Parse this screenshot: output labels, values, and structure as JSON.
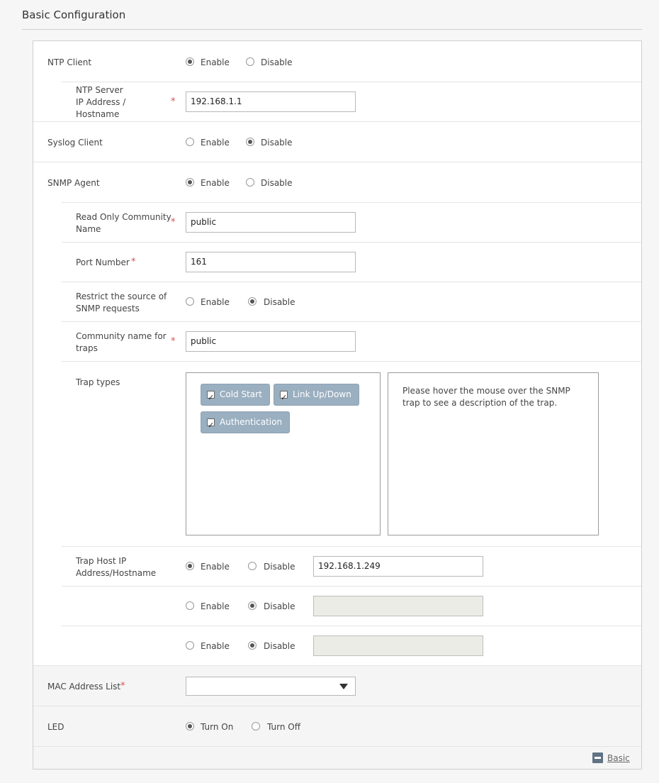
{
  "section_title": "Basic Configuration",
  "ntp": {
    "label": "NTP Client",
    "enable": "Enable",
    "disable": "Disable",
    "server_label_1": "NTP Server",
    "server_label_2": "IP Address /",
    "server_label_3": "Hostname",
    "server_value": "192.168.1.1"
  },
  "syslog": {
    "label": "Syslog Client",
    "enable": "Enable",
    "disable": "Disable"
  },
  "snmp": {
    "label": "SNMP Agent",
    "enable": "Enable",
    "disable": "Disable",
    "ro_label_1": "Read Only Community",
    "ro_label_2": "Name",
    "ro_value": "public",
    "port_label": "Port Number",
    "port_value": "161",
    "restrict_label_1": "Restrict the source of",
    "restrict_label_2": "SNMP requests",
    "trap_comm_label_1": "Community name for",
    "trap_comm_label_2": "traps",
    "trap_comm_value": "public",
    "trap_types_label": "Trap types",
    "trap_types": [
      "Cold Start",
      "Link Up/Down",
      "Authentication"
    ],
    "trap_hint": "Please hover the mouse over the SNMP trap to see a description of the trap.",
    "trap_host_label_1": "Trap Host IP",
    "trap_host_label_2": "Address/Hostname",
    "trap_host_value": "192.168.1.249"
  },
  "required_mark": "*",
  "mac": {
    "label": "MAC Address List",
    "value": ""
  },
  "led": {
    "label": "LED",
    "on": "Turn On",
    "off": "Turn Off"
  },
  "footer": {
    "link": "Basic"
  }
}
